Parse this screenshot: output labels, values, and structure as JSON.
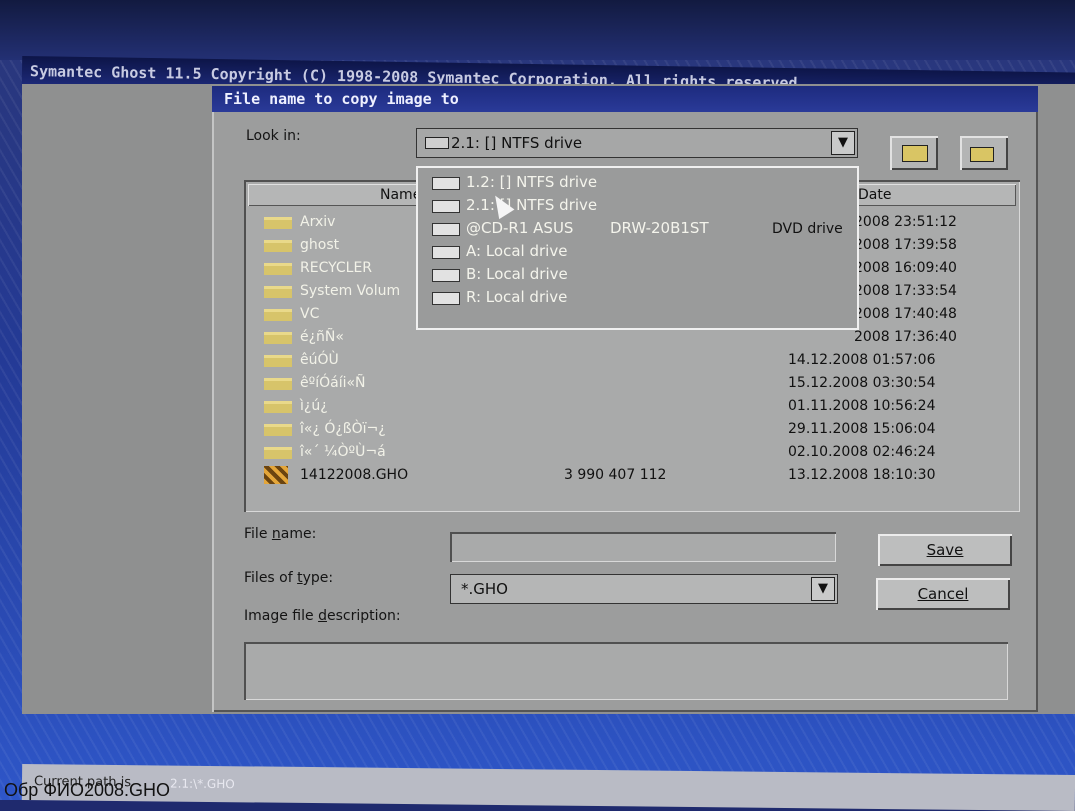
{
  "app": {
    "title": "Symantec Ghost 11.5   Copyright (C) 1998-2008 Symantec Corporation. All rights reserved."
  },
  "dialog": {
    "title": "File name to copy image to",
    "look_in_label": "Look in:",
    "look_in_value": "2.1: [] NTFS drive",
    "drop_glyph": "▼",
    "up_folder_icon": "folder-up-icon",
    "new_folder_icon": "new-folder-icon"
  },
  "list": {
    "headers": {
      "name": "Name",
      "date": "Date"
    },
    "rows": [
      {
        "name": "Arxiv",
        "size": "",
        "date": "2008 23:51:12",
        "icon": "folder-icon"
      },
      {
        "name": "ghost",
        "size": "",
        "date": "2008 17:39:58",
        "icon": "folder-icon"
      },
      {
        "name": "RECYCLER",
        "size": "",
        "date": "2008 16:09:40",
        "icon": "folder-icon"
      },
      {
        "name": "System Volum",
        "size": "",
        "date": "2008 17:33:54",
        "icon": "folder-icon"
      },
      {
        "name": "VC",
        "size": "",
        "date": "2008 17:40:48",
        "icon": "folder-icon"
      },
      {
        "name": "é¿ñÑ«",
        "size": "",
        "date": "2008 17:36:40",
        "icon": "folder-icon"
      },
      {
        "name": "êúÓÙ",
        "size": "",
        "date": "14.12.2008 01:57:06",
        "icon": "folder-icon"
      },
      {
        "name": "êºíÓáíi«Ñ",
        "size": "",
        "date": "15.12.2008 03:30:54",
        "icon": "folder-icon"
      },
      {
        "name": "ì¿ú¿",
        "size": "",
        "date": "01.11.2008 10:56:24",
        "icon": "folder-icon"
      },
      {
        "name": "î«¿ Ó¿ßÒï¬¿",
        "size": "",
        "date": "29.11.2008 15:06:04",
        "icon": "folder-icon"
      },
      {
        "name": "î«´ ¼ÒºÙ¬á",
        "size": "",
        "date": "02.10.2008 02:46:24",
        "icon": "folder-icon"
      },
      {
        "name": "14122008.GHO",
        "size": "3 990 407 112",
        "date": "13.12.2008 18:10:30",
        "icon": "ghost-image-icon"
      }
    ]
  },
  "dropdown": {
    "items": [
      {
        "label": "1.2: [] NTFS drive",
        "extra": "",
        "type": "",
        "icon": "hard-drive-icon"
      },
      {
        "label": "2.1: [] NTFS drive",
        "extra": "",
        "type": "",
        "icon": "hard-drive-icon"
      },
      {
        "label": "@CD-R1 ASUS",
        "extra": "DRW-20B1ST",
        "type": "DVD drive",
        "icon": "dvd-drive-icon"
      },
      {
        "label": "A: Local drive",
        "extra": "",
        "type": "",
        "icon": "floppy-drive-icon"
      },
      {
        "label": "B: Local drive",
        "extra": "",
        "type": "",
        "icon": "floppy-drive-icon"
      },
      {
        "label": "R: Local drive",
        "extra": "",
        "type": "",
        "icon": "local-drive-icon"
      }
    ]
  },
  "form": {
    "file_name_label": "File name:",
    "file_name_value": "",
    "files_of_type_label": "Files of type:",
    "files_of_type_value": "*.GHO",
    "description_label": "Image file description:",
    "description_value": ""
  },
  "buttons": {
    "save": "Save",
    "cancel": "Cancel"
  },
  "status": {
    "label": "Current path is",
    "path": "2.1:\\*.GHO"
  },
  "overlay_caption": "Обр                                                   ФИО2008.GHO"
}
